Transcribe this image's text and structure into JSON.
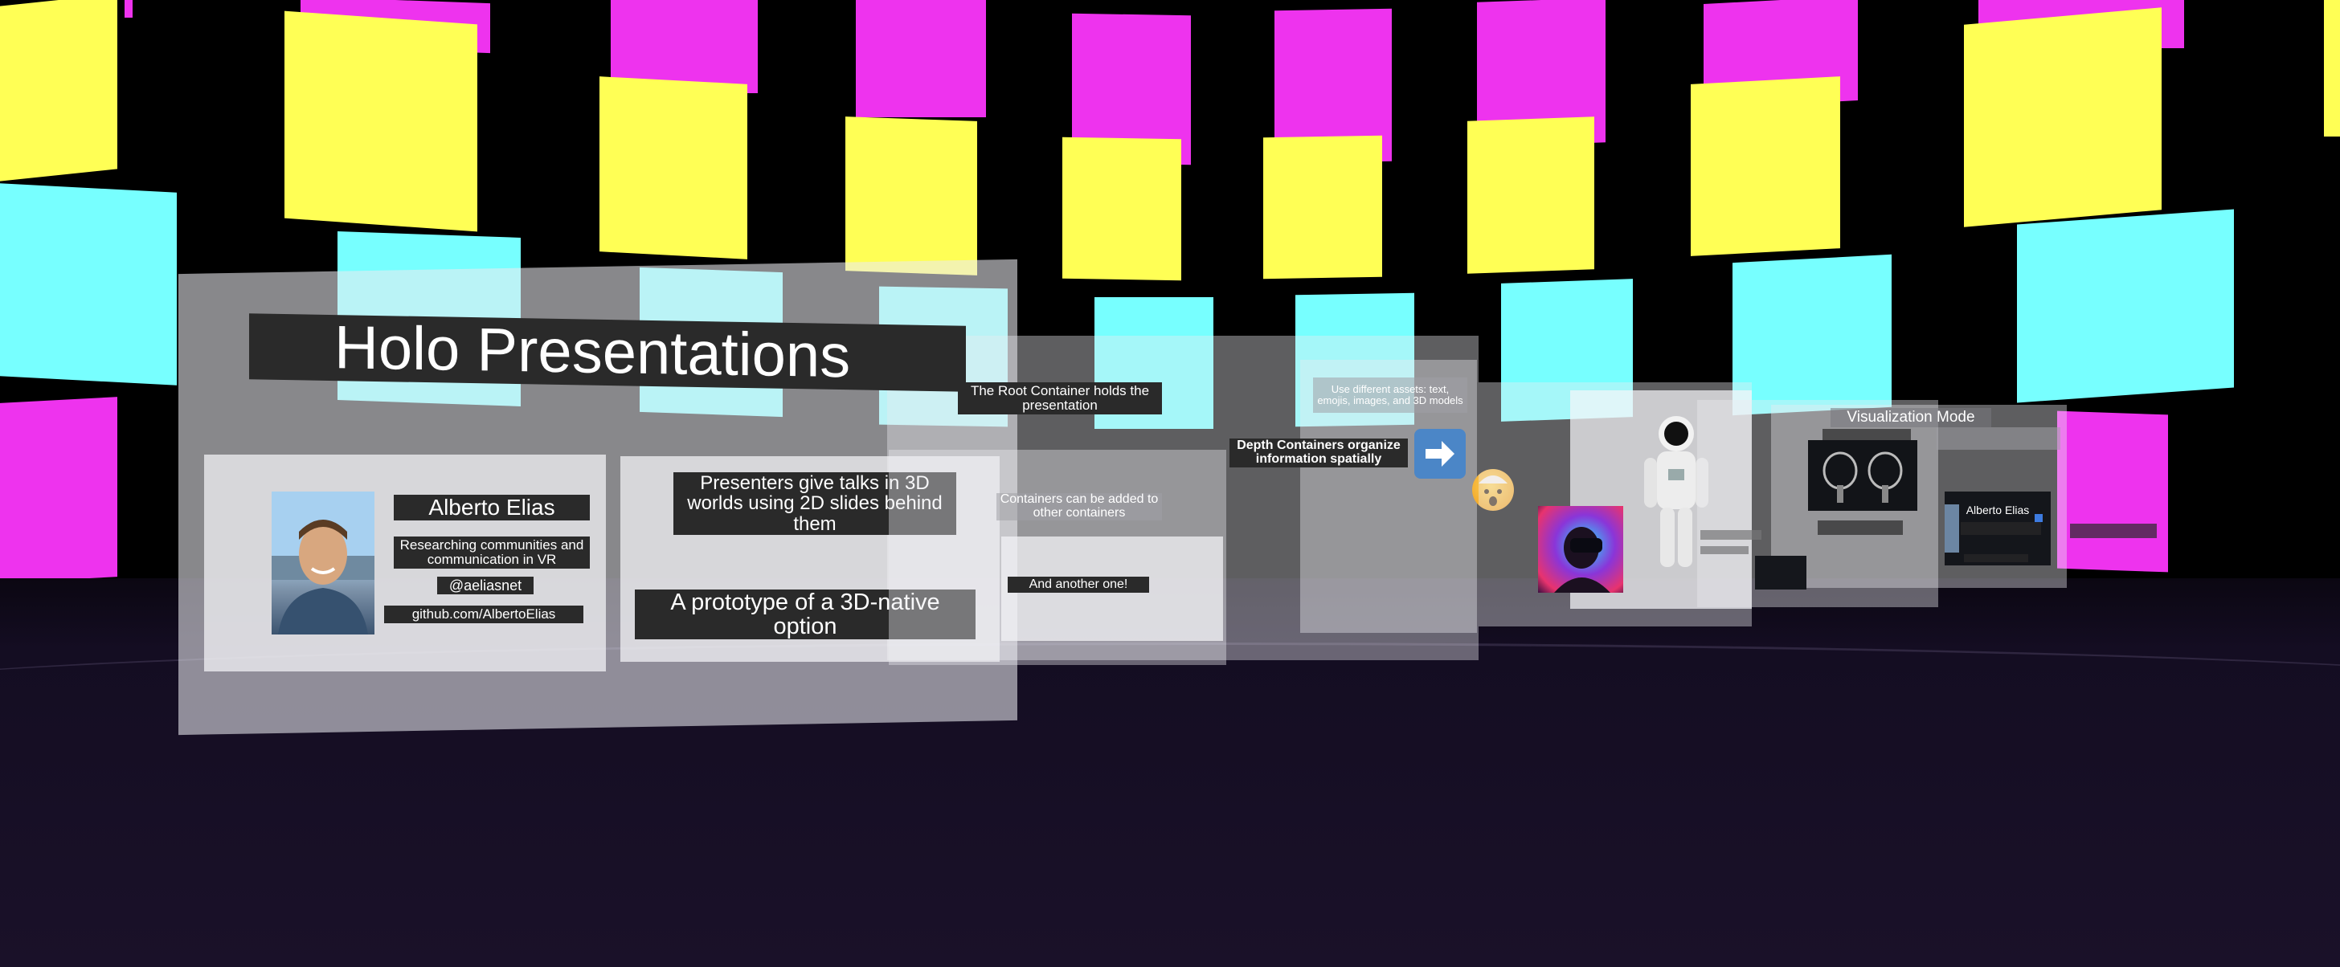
{
  "colors": {
    "background": "#000000",
    "yellow_tiles": "#ffff55",
    "magenta_tiles": "#ee33ee",
    "cyan_tiles": "#77ffff",
    "label_background": "#2a2a2a",
    "arrow_button": "#4b86c7"
  },
  "icons": {
    "arrow": "arrow-right-icon",
    "emoji": "exploding-head-emoji-icon",
    "astronaut": "astronaut-model-icon",
    "vr_headset": "vr-headset-image-icon",
    "controllers": "vr-controllers-icon"
  },
  "title": {
    "text": "Holo Presentations"
  },
  "speaker": {
    "name": "Alberto Elias",
    "bio": "Researching communities and communication in VR",
    "handle": "@aeliasnet",
    "github": "github.com/AlbertoElias"
  },
  "slides": {
    "presenters": "Presenters give talks in 3D worlds using 2D slides behind them",
    "prototype": "A prototype of a 3D-native option",
    "root_container": "The Root Container holds the presentation",
    "containers_nested": "Containers can be added to other containers",
    "another": "And another one!",
    "assets": "Use different assets: text, emojis, images, and 3D models",
    "depth_containers": "Depth Containers organize information spatially",
    "visualization_mode": "Visualization Mode",
    "far_speaker": "Alberto Elias"
  }
}
